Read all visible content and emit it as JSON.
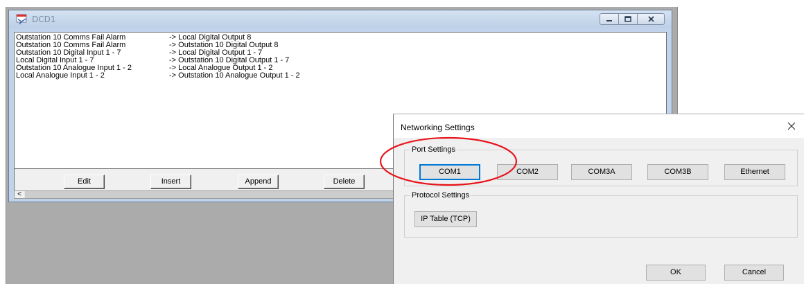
{
  "child_window": {
    "title": "DCD1",
    "icon": "application-icon",
    "caption_buttons": [
      "minimize-icon",
      "maximize-icon",
      "close-icon"
    ],
    "mappings": [
      {
        "source": "Outstation 10 Comms Fail Alarm",
        "destination": "-> Local Digital Output 8"
      },
      {
        "source": "Outstation 10 Comms Fail Alarm",
        "destination": "-> Outstation 10 Digital Output 8"
      },
      {
        "source": "Outstation 10 Digital Input 1 - 7",
        "destination": "-> Local Digital Output 1 - 7"
      },
      {
        "source": "Local Digital Input 1 - 7",
        "destination": "-> Outstation 10 Digital Output 1 - 7"
      },
      {
        "source": "Outstation 10 Analogue Input 1 - 2",
        "destination": "-> Local Analogue Output 1 - 2"
      },
      {
        "source": "Local Analogue Input 1 - 2",
        "destination": "-> Outstation 10 Analogue Output 1 - 2"
      }
    ],
    "buttons": {
      "edit": "Edit",
      "insert": "Insert",
      "append": "Append",
      "delete": "Delete"
    },
    "scroll_left_glyph": "<"
  },
  "dialog": {
    "title": "Networking Settings",
    "close_glyph": "×",
    "port_settings": {
      "legend": "Port Settings",
      "buttons": [
        "COM1",
        "COM2",
        "COM3A",
        "COM3B",
        "Ethernet"
      ]
    },
    "protocol_settings": {
      "legend": "Protocol Settings",
      "buttons": [
        "IP Table (TCP)"
      ]
    },
    "ok_label": "OK",
    "cancel_label": "Cancel"
  },
  "annotation": {
    "color": "#e8141c",
    "shape": "ellipse"
  }
}
